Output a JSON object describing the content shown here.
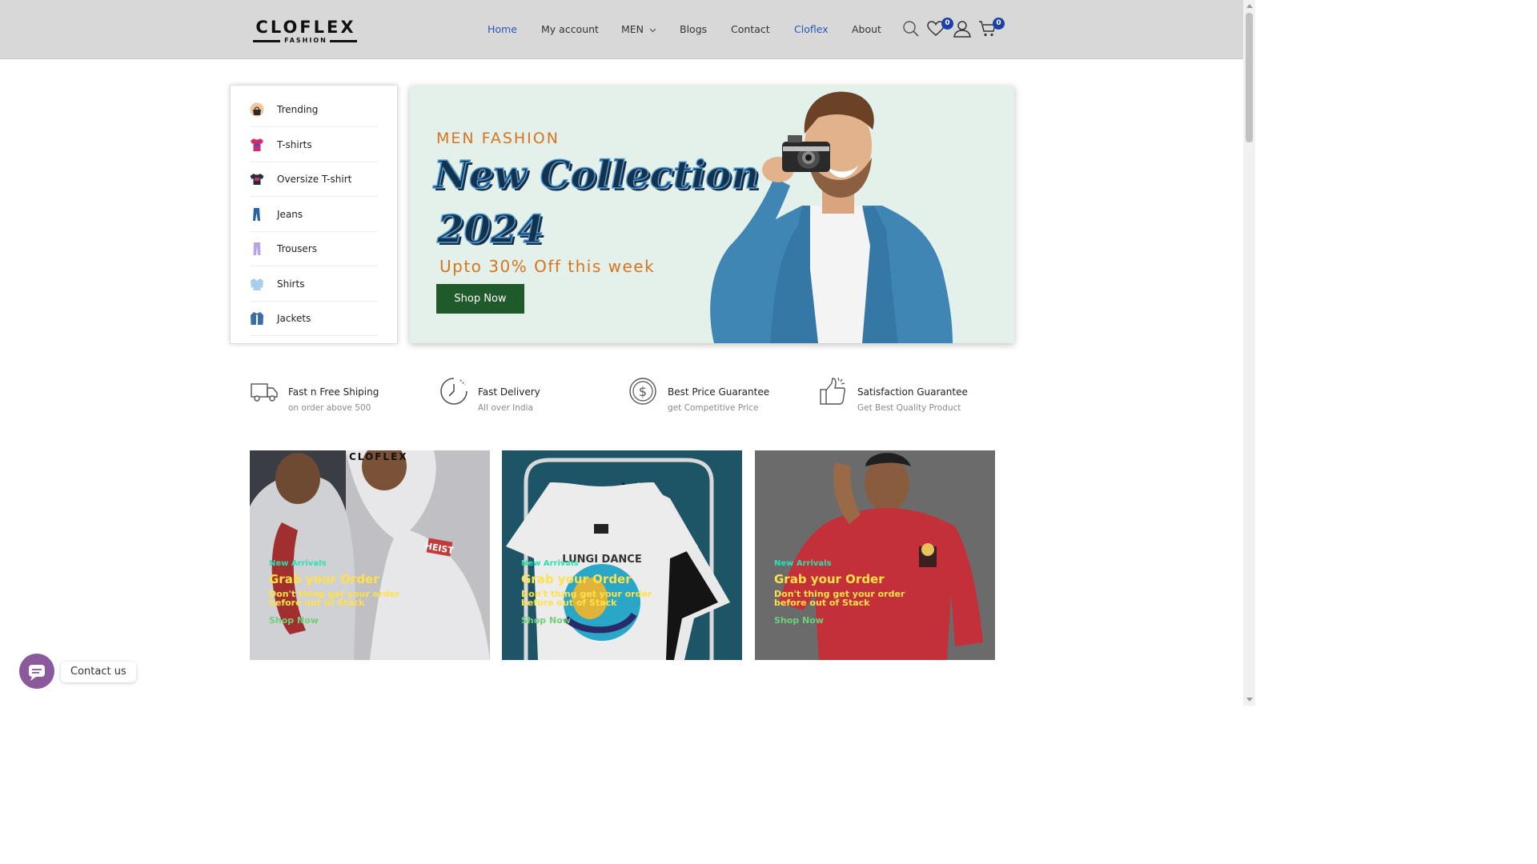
{
  "brand": {
    "name": "CLOFLEX",
    "tagline": "FASHION"
  },
  "nav": {
    "items": [
      {
        "label": "Home"
      },
      {
        "label": "My account"
      },
      {
        "label": "MEN"
      },
      {
        "label": "Blogs"
      },
      {
        "label": "Contact"
      },
      {
        "label": "Cloflex"
      },
      {
        "label": "About"
      }
    ],
    "wishlist_count": "0",
    "cart_count": "0"
  },
  "categories": [
    {
      "label": "Trending",
      "icon": "bag-icon"
    },
    {
      "label": "T-shirts",
      "icon": "tshirt-icon"
    },
    {
      "label": "Oversize T-shirt",
      "icon": "oversize-tshirt-icon"
    },
    {
      "label": "Jeans",
      "icon": "jeans-icon"
    },
    {
      "label": "Trousers",
      "icon": "trousers-icon"
    },
    {
      "label": "Shirts",
      "icon": "shirt-icon"
    },
    {
      "label": "Jackets",
      "icon": "jacket-icon"
    }
  ],
  "hero": {
    "eyebrow": "MEN FASHION",
    "title_line1": "New Collection",
    "title_line2": "2024",
    "offer": "Upto 30% Off this week",
    "button": "Shop Now"
  },
  "features": [
    {
      "title": "Fast n Free Shiping",
      "subtitle": "on order above 500",
      "icon": "truck-icon"
    },
    {
      "title": "Fast Delivery",
      "subtitle": "All over India",
      "icon": "clock-icon"
    },
    {
      "title": "Best Price Guarantee",
      "subtitle": "get Competitive Price",
      "icon": "dollar-icon"
    },
    {
      "title": "Satisfaction Guarantee",
      "subtitle": "Get Best Quality Product",
      "icon": "thumbs-up-icon"
    }
  ],
  "promos": [
    {
      "tag": "New Arrivals",
      "heading": "Grab your Order",
      "text": "Don't thing get your order before out of Stack",
      "cta": "Shop Now",
      "watermark": "CLOFLEX",
      "print": "HEIST"
    },
    {
      "tag": "New Arrivals",
      "heading": "Grab your Order",
      "text": "Don't thing get your order before out of Stack",
      "cta": "Shop Now",
      "print": "LUNGI DANCE"
    },
    {
      "tag": "New Arrivals",
      "heading": "Grab your Order",
      "text": "Don't thing get your order before out of Stack",
      "cta": "Shop Now"
    }
  ],
  "contact_widget": {
    "label": "Contact us"
  },
  "colors": {
    "header_bg": "#d8d8d8",
    "nav_active": "#2a55b8",
    "badge": "#1c3fa8",
    "hero_bg": "#e3f1ea",
    "accent_orange": "#d8731f",
    "button_green": "#1f5a2a",
    "promo_heading": "#ffe14a",
    "promo_tag": "#2de0b0"
  }
}
